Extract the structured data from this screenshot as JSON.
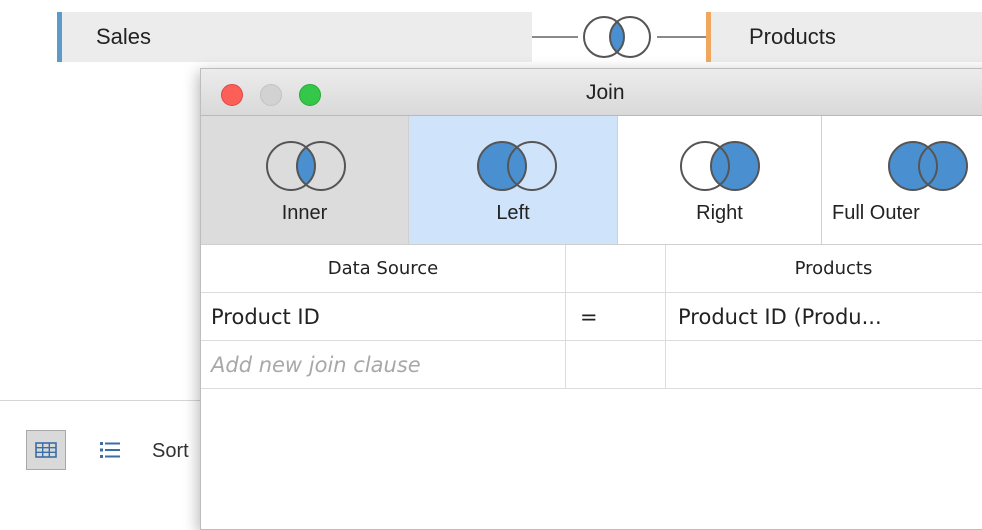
{
  "canvas": {
    "left_table": "Sales",
    "right_table": "Products",
    "left_table_color": "#5b9bc9",
    "right_table_color": "#f0a860",
    "join_indicator_icon": "inner-join-icon"
  },
  "toolbar": {
    "grid_view_icon": "grid-view-icon",
    "list_view_icon": "list-view-icon",
    "sort_label": "Sort"
  },
  "dialog": {
    "title": "Join",
    "join_types": [
      {
        "label": "Inner",
        "icon": "inner-join-icon",
        "selected": false
      },
      {
        "label": "Left",
        "icon": "left-join-icon",
        "selected": true
      },
      {
        "label": "Right",
        "icon": "right-join-icon",
        "selected": false
      },
      {
        "label": "Full Outer",
        "icon": "full-outer-join-icon",
        "selected": false
      }
    ],
    "accent_color": "#4a90d0",
    "selected_bg": "#cfe4fb",
    "clause_table": {
      "headers": [
        "Data Source",
        "",
        "Products"
      ],
      "rows": [
        {
          "left_field": "Product ID",
          "operator": "=",
          "right_field": "Product ID (Produ..."
        }
      ],
      "add_placeholder": "Add new join clause"
    }
  }
}
